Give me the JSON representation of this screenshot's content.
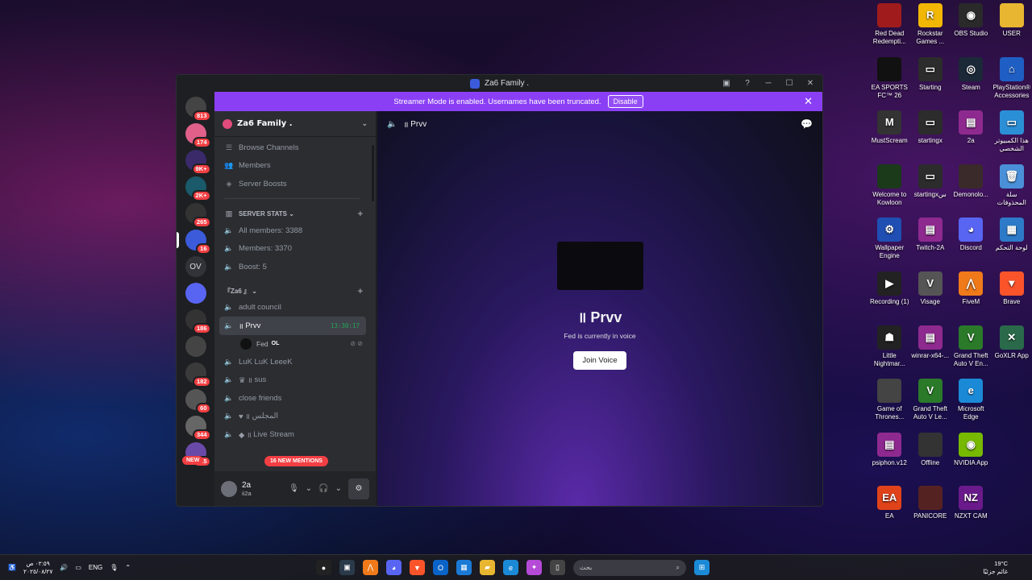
{
  "desktop": {
    "icons": [
      {
        "label": "Red Dead Redempti...",
        "color": "#a01c1c",
        "glyph": ""
      },
      {
        "label": "Rockstar Games ...",
        "color": "#f2b705",
        "glyph": "R"
      },
      {
        "label": "OBS Studio",
        "color": "#2a2a2a",
        "glyph": "◉"
      },
      {
        "label": "USER",
        "color": "#e8b630",
        "glyph": ""
      },
      {
        "label": "EA SPORTS FC™ 26",
        "color": "#111111",
        "glyph": ""
      },
      {
        "label": "Starting",
        "color": "#2c2c2c",
        "glyph": "▭"
      },
      {
        "label": "Steam",
        "color": "#1b2838",
        "glyph": "◎"
      },
      {
        "label": "PlayStation® Accessories",
        "color": "#1f5fc4",
        "glyph": "⌂"
      },
      {
        "label": "MustScream",
        "color": "#333333",
        "glyph": "M"
      },
      {
        "label": "startingx",
        "color": "#2c2c2c",
        "glyph": "▭"
      },
      {
        "label": "2a",
        "color": "#8e2a8f",
        "glyph": "▤"
      },
      {
        "label": "هذا الكمبيوتر الشخصي",
        "color": "#2b8fd6",
        "glyph": "▭"
      },
      {
        "label": "Welcome to Kowloon",
        "color": "#1a3a1a",
        "glyph": ""
      },
      {
        "label": "startingxس",
        "color": "#2c2c2c",
        "glyph": "▭"
      },
      {
        "label": "Demonolo...",
        "color": "#3a2a2a",
        "glyph": ""
      },
      {
        "label": "سلة المحذوفات",
        "color": "#4a90d9",
        "glyph": "🗑"
      },
      {
        "label": "Wallpaper Engine",
        "color": "#1f4fb3",
        "glyph": "⚙"
      },
      {
        "label": "Twitch-2A",
        "color": "#8e2a8f",
        "glyph": "▤"
      },
      {
        "label": "Discord",
        "color": "#5865f2",
        "glyph": "◕"
      },
      {
        "label": "لوحة التحكم",
        "color": "#2d7ac8",
        "glyph": "▦"
      },
      {
        "label": "Recording (1)",
        "color": "#222222",
        "glyph": "▶"
      },
      {
        "label": "Visage",
        "color": "#555555",
        "glyph": "V"
      },
      {
        "label": "FiveM",
        "color": "#f07a1a",
        "glyph": "⋀"
      },
      {
        "label": "Brave",
        "color": "#fb542b",
        "glyph": "▼"
      },
      {
        "label": "Little Nightmar...",
        "color": "#222222",
        "glyph": "☗"
      },
      {
        "label": "winrar-x64-...",
        "color": "#8e2a8f",
        "glyph": "▤"
      },
      {
        "label": "Grand Theft Auto V En...",
        "color": "#2a7a2a",
        "glyph": "V"
      },
      {
        "label": "GoXLR App",
        "color": "#2a6a4a",
        "glyph": "✕"
      },
      {
        "label": "Game of Thrones...",
        "color": "#444444",
        "glyph": ""
      },
      {
        "label": "Grand Theft Auto V Le...",
        "color": "#2a7a2a",
        "glyph": "V"
      },
      {
        "label": "Microsoft Edge",
        "color": "#1b8ad6",
        "glyph": "e"
      },
      {
        "label": "",
        "color": "transparent",
        "glyph": ""
      },
      {
        "label": "psiphon.v12",
        "color": "#8e2a8f",
        "glyph": "▤"
      },
      {
        "label": "Offline",
        "color": "#333333",
        "glyph": ""
      },
      {
        "label": "NVIDIA App",
        "color": "#76b900",
        "glyph": "◉"
      },
      {
        "label": "",
        "color": "transparent",
        "glyph": ""
      },
      {
        "label": "EA",
        "color": "#e0431a",
        "glyph": "EA"
      },
      {
        "label": "PANICORE",
        "color": "#552222",
        "glyph": ""
      },
      {
        "label": "NZXT CAM",
        "color": "#6a1a8a",
        "glyph": "NZ"
      }
    ]
  },
  "window": {
    "title": "Za6 Family .",
    "banner_text": "Streamer Mode is enabled. Usernames have been truncated.",
    "banner_button": "Disable"
  },
  "servers": [
    {
      "badge": "813",
      "color": "#444"
    },
    {
      "badge": "174",
      "color": "#e0608a"
    },
    {
      "badge": "9K+",
      "color": "#3a2a6a"
    },
    {
      "badge": "2K+",
      "color": "#1a5a6a"
    },
    {
      "badge": "265",
      "color": "#333"
    },
    {
      "badge": "16",
      "color": "#3b5bdb"
    },
    {
      "badge": "",
      "color": "#313338",
      "text": "OV"
    },
    {
      "badge": "",
      "color": "#5865f2"
    },
    {
      "badge": "186",
      "color": "#333"
    },
    {
      "badge": "",
      "color": "#444"
    },
    {
      "badge": "182",
      "color": "#3a3a3a"
    },
    {
      "badge": "60",
      "color": "#555"
    },
    {
      "badge": "344",
      "color": "#666"
    },
    {
      "badge": "115",
      "color": "#6a4aa8"
    }
  ],
  "rail_new": "NEW",
  "sidebar": {
    "guild_name": "Za6 Family .",
    "menu": [
      "Browse Channels",
      "Members",
      "Server Boosts"
    ],
    "cat1": "SERVER STATS",
    "stats": [
      "All members: 3388",
      "Members: 3370",
      "Boost: 5"
    ],
    "cat2": "『Za6 』",
    "channels": {
      "adult": "adult council",
      "prvv": "Prvv",
      "prvv_time": "13:30:17",
      "fed_name": "Fed",
      "fed_tag": "OL",
      "luk": "LuK LuK LeeeK",
      "sus": "sus",
      "close": "close friends",
      "majlis": "المجلس",
      "live": "Live Stream"
    },
    "mentions": "16 NEW MENTIONS",
    "user_name": "2a",
    "user_status": "ii2a"
  },
  "main": {
    "channel": "Prvv",
    "voice_name": "Prvv",
    "voice_sub": "Fed is currently in voice",
    "join_label": "Join Voice"
  },
  "taskbar": {
    "time": "٠٢:٥٩ ص",
    "date": "٢٠٢٥/٠٨/٢٧",
    "lang": "ENG",
    "search_placeholder": "بحث",
    "temp": "19°C",
    "weather": "غائم جزئيًا"
  }
}
